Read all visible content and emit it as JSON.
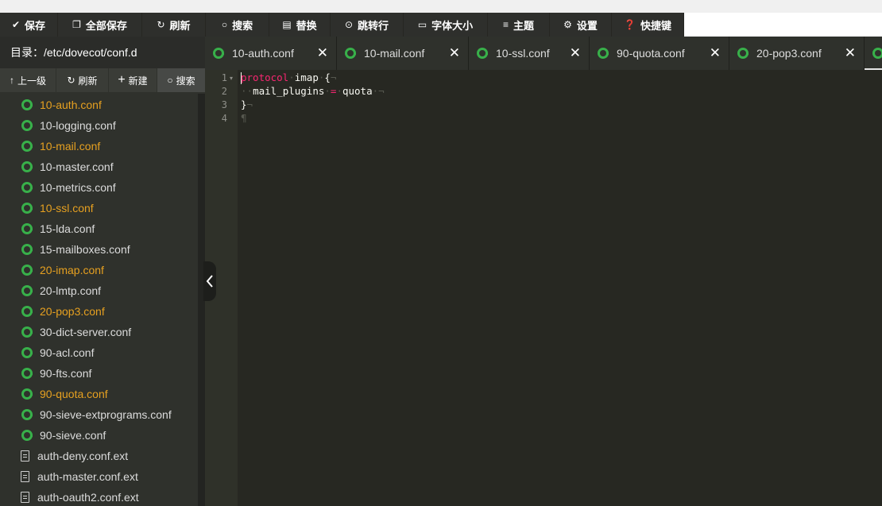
{
  "toolbar": {
    "items": [
      {
        "icon": "check-icon",
        "glyph": "✔",
        "label": "保存"
      },
      {
        "icon": "copy-icon",
        "glyph": "❐",
        "label": "全部保存"
      },
      {
        "icon": "refresh-icon",
        "glyph": "↻",
        "label": "刷新"
      },
      {
        "icon": "search-icon",
        "glyph": "○",
        "label": "搜索"
      },
      {
        "icon": "replace-icon",
        "glyph": "▤",
        "label": "替换"
      },
      {
        "icon": "goto-icon",
        "glyph": "⊙",
        "label": "跳转行"
      },
      {
        "icon": "font-icon",
        "glyph": "▭",
        "label": "字体大小"
      },
      {
        "icon": "menu-icon",
        "glyph": "≡",
        "label": "主题"
      },
      {
        "icon": "gear-icon",
        "glyph": "⚙",
        "label": "设置"
      },
      {
        "icon": "help-icon",
        "glyph": "❓",
        "label": "快捷键"
      }
    ]
  },
  "sidebar": {
    "directory_label": "目录：/etc/dovecot/conf.d",
    "actions": [
      {
        "icon": "arrow-up-icon",
        "glyph": "↑",
        "label": "上一级"
      },
      {
        "icon": "refresh-icon",
        "glyph": "↻",
        "label": "刷新"
      },
      {
        "icon": "plus-icon",
        "glyph": "+",
        "label": "新建"
      },
      {
        "icon": "search-icon",
        "glyph": "○",
        "label": "搜索"
      }
    ],
    "files": [
      {
        "name": "10-auth.conf",
        "type": "conf",
        "open": true
      },
      {
        "name": "10-logging.conf",
        "type": "conf",
        "open": false
      },
      {
        "name": "10-mail.conf",
        "type": "conf",
        "open": true
      },
      {
        "name": "10-master.conf",
        "type": "conf",
        "open": false
      },
      {
        "name": "10-metrics.conf",
        "type": "conf",
        "open": false
      },
      {
        "name": "10-ssl.conf",
        "type": "conf",
        "open": true
      },
      {
        "name": "15-lda.conf",
        "type": "conf",
        "open": false
      },
      {
        "name": "15-mailboxes.conf",
        "type": "conf",
        "open": false
      },
      {
        "name": "20-imap.conf",
        "type": "conf",
        "open": true
      },
      {
        "name": "20-lmtp.conf",
        "type": "conf",
        "open": false
      },
      {
        "name": "20-pop3.conf",
        "type": "conf",
        "open": true
      },
      {
        "name": "30-dict-server.conf",
        "type": "conf",
        "open": false
      },
      {
        "name": "90-acl.conf",
        "type": "conf",
        "open": false
      },
      {
        "name": "90-fts.conf",
        "type": "conf",
        "open": false
      },
      {
        "name": "90-quota.conf",
        "type": "conf",
        "open": true
      },
      {
        "name": "90-sieve-extprograms.conf",
        "type": "conf",
        "open": false
      },
      {
        "name": "90-sieve.conf",
        "type": "conf",
        "open": false
      },
      {
        "name": "auth-deny.conf.ext",
        "type": "doc",
        "open": false
      },
      {
        "name": "auth-master.conf.ext",
        "type": "doc",
        "open": false
      },
      {
        "name": "auth-oauth2.conf.ext",
        "type": "doc",
        "open": false
      }
    ]
  },
  "tabs": [
    {
      "name": "10-auth.conf",
      "close": "✕"
    },
    {
      "name": "10-mail.conf",
      "close": "✕"
    },
    {
      "name": "10-ssl.conf",
      "close": "✕"
    },
    {
      "name": "90-quota.conf",
      "close": "✕"
    },
    {
      "name": "20-pop3.conf",
      "close": "✕"
    }
  ],
  "editor": {
    "line_numbers": [
      "1",
      "2",
      "3",
      "4"
    ],
    "lines": [
      {
        "keyword": "protocol",
        "sp1": "·",
        "text": "imap",
        "sp2": "·",
        "brace": "{",
        "eol": "¬"
      },
      {
        "indent": "··",
        "key": "mail_plugins",
        "sp1": "·",
        "op": "=",
        "sp2": "·",
        "value": "quota",
        "sp3": "·",
        "eol": "¬"
      },
      {
        "brace": "}",
        "eol": "¬"
      },
      {
        "eol": "¶"
      }
    ]
  },
  "colors": {
    "toolbar_bg": "#2e2f2c",
    "sidebar_bg": "#2f312c",
    "editor_bg": "#272822",
    "open_file": "#e6a020",
    "file_icon": "#38b04a",
    "keyword": "#f92672"
  }
}
